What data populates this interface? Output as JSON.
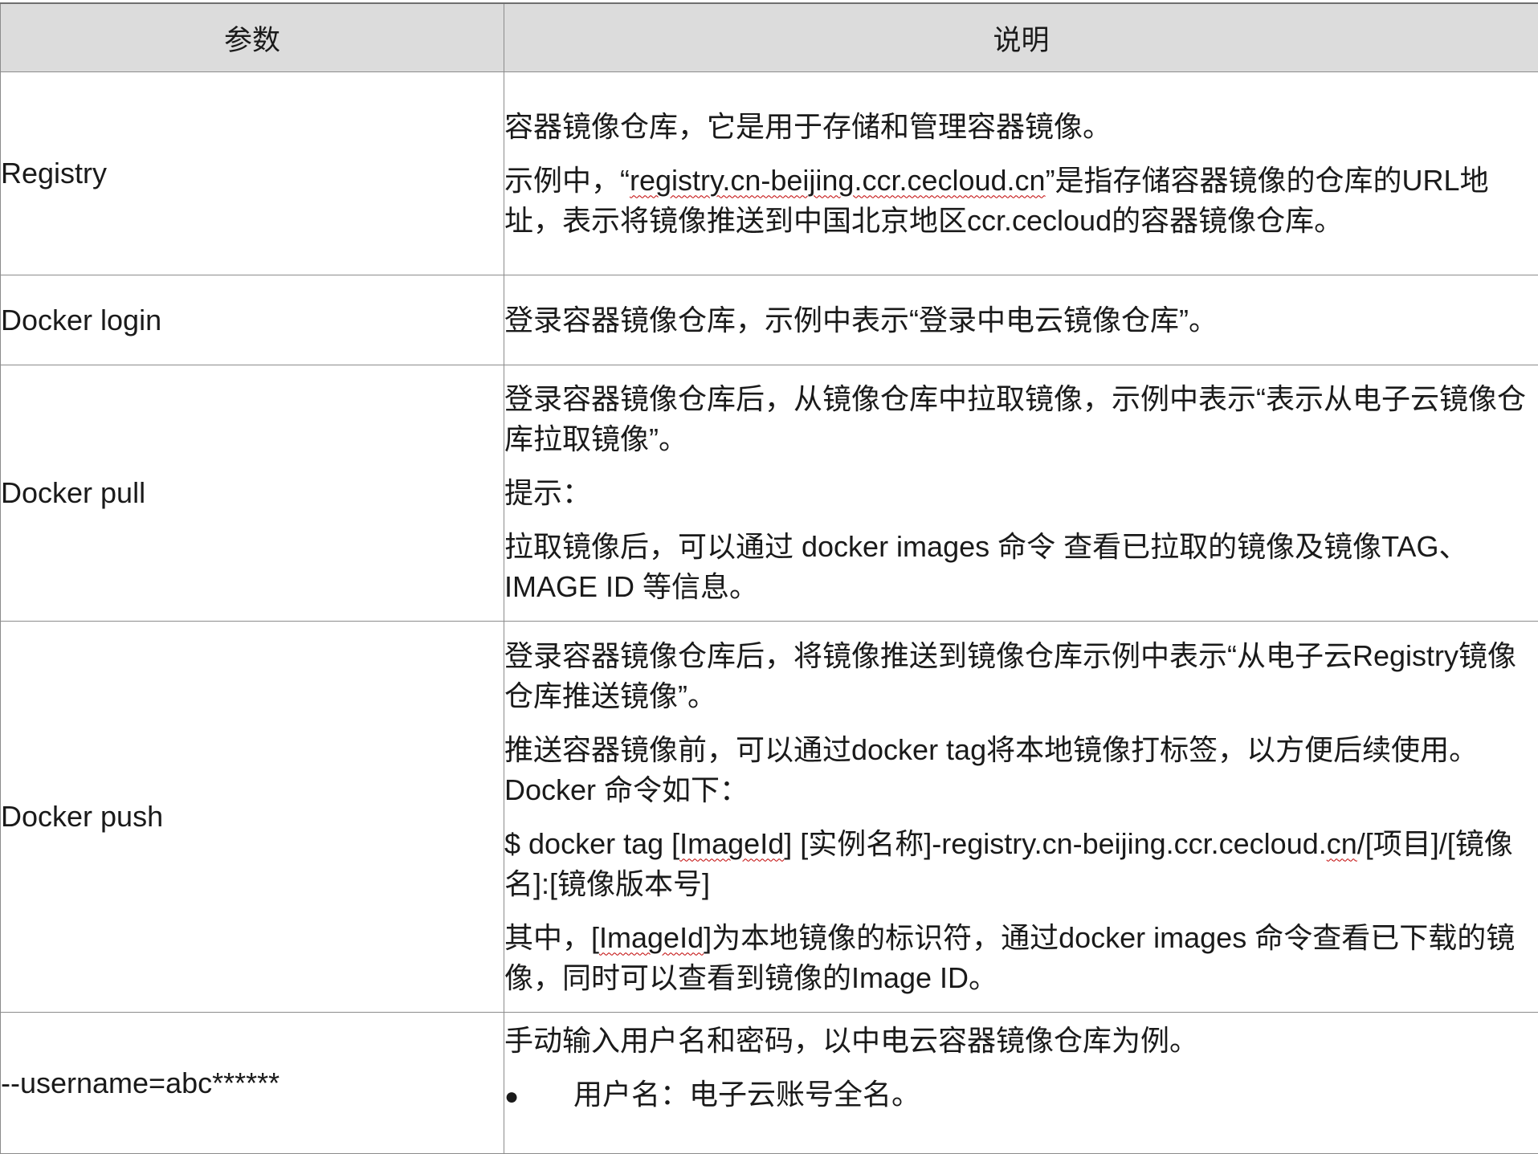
{
  "header": {
    "col_param": "参数",
    "col_desc": "说明"
  },
  "rows": [
    {
      "param": "Registry",
      "desc": [
        "容器镜像仓库，它是用于存储和管理容器镜像。",
        [
          "示例中，“",
          "registry.cn-beijing.ccr.cecloud.cn",
          "”是指存储容器镜像的仓库的URL地址，表示将镜像推送到中国北京地区ccr.cecloud的容器镜像仓库。"
        ]
      ]
    },
    {
      "param": "Docker login",
      "desc": [
        "登录容器镜像仓库，示例中表示“登录中电云镜像仓库”。"
      ]
    },
    {
      "param": "Docker pull",
      "desc": [
        "登录容器镜像仓库后，从镜像仓库中拉取镜像，示例中表示“表示从电子云镜像仓库拉取镜像”。",
        "提示：",
        "拉取镜像后，可以通过 docker images 命令 查看已拉取的镜像及镜像TAG、IMAGE ID 等信息。"
      ]
    },
    {
      "param": "Docker push",
      "desc": [
        "登录容器镜像仓库后，将镜像推送到镜像仓库示例中表示“从电子云Registry镜像仓库推送镜像”。",
        "推送容器镜像前，可以通过docker tag将本地镜像打标签，以方便后续使用。Docker 命令如下：",
        [
          "$ docker tag [",
          "ImageId",
          "] [实例名称]-registry.cn-beijing.ccr.cecloud.",
          "cn",
          "/[项目]/[镜像名]:[镜像版本号]"
        ],
        [
          "其中，[",
          "ImageId",
          "]为本地镜像的标识符，通过docker images 命令查看已下载的镜像，同时可以查看到镜像的Image ID。"
        ]
      ]
    },
    {
      "param": "--username=abc******",
      "desc": [
        "手动输入用户名和密码，以中电云容器镜像仓库为例。"
      ],
      "bullets": [
        "用户名：电子云账号全名。"
      ]
    }
  ]
}
